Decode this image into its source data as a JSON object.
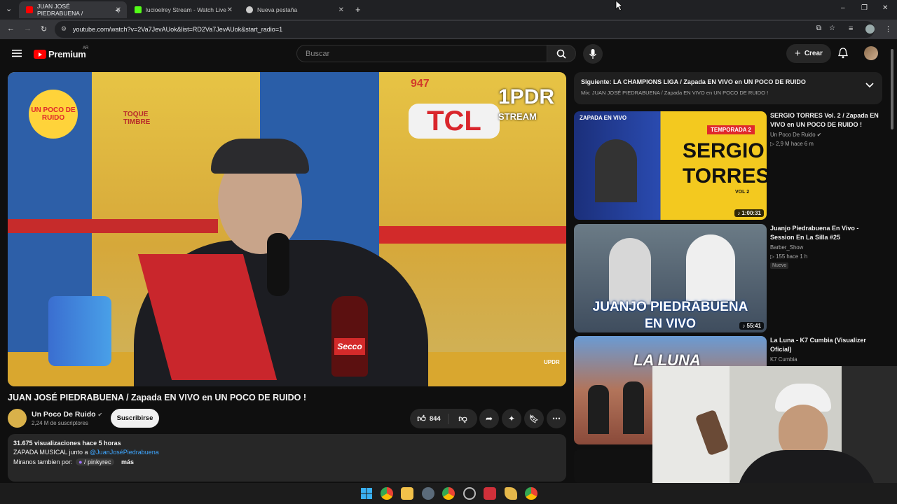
{
  "browser": {
    "tabs": [
      {
        "title": "JUAN JOSÉ PIEDRABUENA /",
        "icon": "youtube-icon",
        "color": "#ff0000"
      },
      {
        "title": "lucioelrey Stream - Watch Live",
        "icon": "kick-icon",
        "color": "#53fc18"
      },
      {
        "title": "Nueva pestaña",
        "icon": "chrome-icon",
        "color": "#cccccc"
      }
    ],
    "new_tab": "+",
    "url": "youtube.com/watch?v=2Va7JevAUok&list=RD2Va7JevAUok&start_radio=1"
  },
  "header": {
    "logo_text": "Premium",
    "country_code": "AR",
    "search_placeholder": "Buscar",
    "create_label": "Crear"
  },
  "video": {
    "title": "JUAN JOSÉ PIEDRABUENA / Zapada EN VIVO en UN POCO DE RUIDO !",
    "overlay_logo": "UN POCO DE RUIDO",
    "overlay_sign": "TOQUE TIMBRE",
    "overlay_tcl": "TCL",
    "overlay_stream_1": "1PDR",
    "overlay_stream_2": "STREAM",
    "overlay_947": "947",
    "overlay_bottle": "Secco",
    "overlay_corner": "UPDR"
  },
  "channel": {
    "name": "Un Poco De Ruido",
    "subscribers": "2,24 M de suscriptores",
    "subscribe_label": "Suscribirse",
    "likes": "844"
  },
  "description": {
    "stats": "31.675 visualizaciones  hace 5 horas",
    "line2_prefix": "ZAPADA MUSICAL junto a ",
    "line2_link": "@JuanJoséPiedrabuena",
    "line3_prefix": "Miranos tambien por:",
    "line3_chip": "/ pinkyrec",
    "more": "más"
  },
  "next_up": {
    "title": "Siguiente: LA CHAMPIONS LIGA / Zapada EN VIVO en UN POCO DE RUIDO",
    "subtitle": "Mix: JUAN JOSÉ PIEDRABUENA / Zapada EN VIVO en UN POCO DE RUIDO !"
  },
  "recommendations": [
    {
      "title": "SERGIO TORRES Vol. 2 / Zapada EN VIVO en UN POCO DE RUIDO !",
      "channel": "Un Poco De Ruido",
      "meta": "▷ 2,9 M   hace 6 m",
      "duration": "1:00:31",
      "thumb_text_1": "SERGIO",
      "thumb_text_2": "TORRES",
      "thumb_badge": "TEMPORADA 2",
      "thumb_small": "ZAPADA EN VIVO",
      "thumb_vol": "VOL 2"
    },
    {
      "title": "Juanjo Piedrabuena En Vivo - Session En La Silla #25",
      "channel": "Barber_Show",
      "meta": "▷ 155   hace 1 h",
      "badge": "Nuevo",
      "duration": "55:41",
      "thumb_text_1": "JUANJO PIEDRABUENA",
      "thumb_text_2": "EN VIVO"
    },
    {
      "title": "La Luna - K7 Cumbia (Visualizer Oficial)",
      "channel": "K7 Cumbia",
      "thumb_text_1": "LA LUNA"
    }
  ]
}
